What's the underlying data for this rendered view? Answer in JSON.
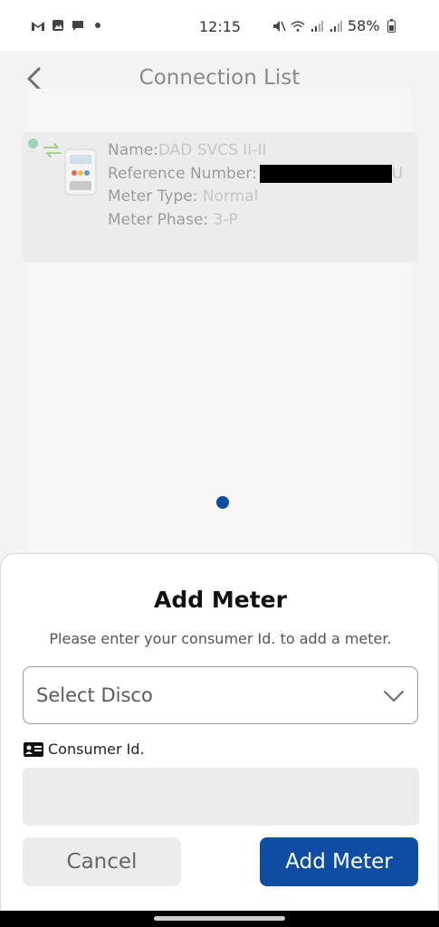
{
  "status_bar": {
    "time": "12:15",
    "battery": "58%",
    "left_icons": [
      "gmail-icon",
      "gallery-icon",
      "chat-icon",
      "dot-icon"
    ],
    "right_icons": [
      "mute-icon",
      "wifi-icon",
      "signal-icon",
      "signal-icon",
      "battery-icon"
    ]
  },
  "header": {
    "title": "Connection List",
    "back_icon": "chevron-left-icon"
  },
  "meter_card": {
    "name_label": "Name:",
    "name_value": "DAD SVCS II-II",
    "reference_label": "Reference Number:",
    "reference_tail": "U",
    "meter_type_label": "Meter Type:",
    "meter_type_value": "Normal",
    "meter_phase_label": "Meter Phase:",
    "meter_phase_value": "3-P",
    "status_color": "#9ad5b8"
  },
  "pager": {
    "active_color": "#0f4da3"
  },
  "sheet": {
    "title": "Add Meter",
    "subtitle": "Please enter your consumer Id. to add a meter.",
    "disco_select": "Select Disco",
    "consumer_label": "Consumer Id.",
    "consumer_value": "",
    "cancel_label": "Cancel",
    "add_label": "Add Meter",
    "primary_color": "#0f4da3"
  }
}
